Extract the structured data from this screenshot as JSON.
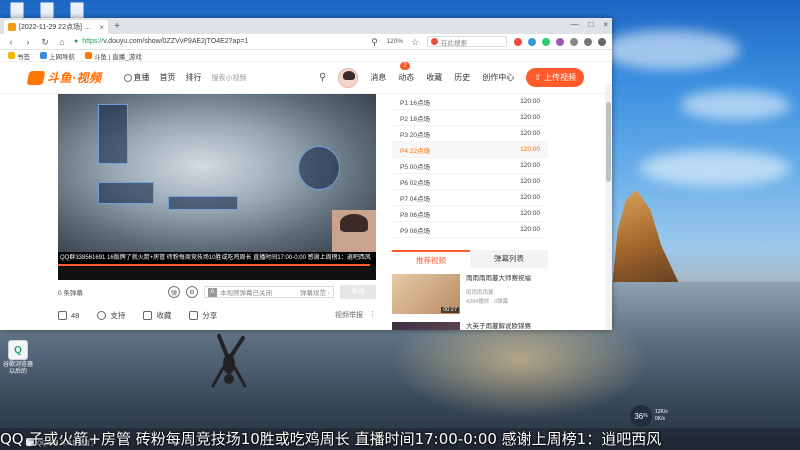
{
  "browser": {
    "tab": {
      "title": "[2022-11-29 22点场] 魔兽世界",
      "close": "×"
    },
    "new_tab": "+",
    "window_controls": [
      "—",
      "□",
      "×"
    ],
    "url": {
      "scheme": "https://",
      "rest": "v.douyu.com/show/0ZZVvP9AE2jTO4E2?ap=1"
    },
    "zoom": "120%",
    "search_placeholder": "在此搜索",
    "bookmarks": [
      "书签",
      "上网导航",
      "斗鱼 | 直播_游戏"
    ]
  },
  "site": {
    "logo_text": "斗鱼·视频",
    "nav": [
      "直播",
      "首页",
      "排行"
    ],
    "nav_muted": "搜索小视频",
    "right_links": [
      "消息",
      "动态",
      "收藏",
      "历史",
      "创作中心"
    ],
    "dynamic_badge": "2",
    "upload_label": "上传视频"
  },
  "video": {
    "ticker": "QQ群338561691 16版牌了就火箭+房管 砖粉每周竞技场10胜或吃鸡周长 直播时间17:00-0:00 感谢上周榜1：逍吧西风",
    "progress": 0.98
  },
  "player_bar": {
    "danmu_count": "0 条弹幕",
    "icon_a_label": "A",
    "danmu_closed": "本视频弹幕已关闭",
    "danmu_spec": "弹幕规范",
    "danmu_spec_arrow": "›",
    "send": "发送"
  },
  "actions": {
    "likes": "48",
    "support": "支持",
    "favorite": "收藏",
    "share": "分享",
    "report": "视频举报",
    "more": "⋮"
  },
  "playlist": [
    {
      "label": "P1 16点场",
      "duration": "120:00",
      "active": false
    },
    {
      "label": "P2 18点场",
      "duration": "120:00",
      "active": false
    },
    {
      "label": "P3 20点场",
      "duration": "120:00",
      "active": false
    },
    {
      "label": "P4 22点场",
      "duration": "120:00",
      "active": true
    },
    {
      "label": "P5 00点场",
      "duration": "120:00",
      "active": false
    },
    {
      "label": "P6 02点场",
      "duration": "120:00",
      "active": false
    },
    {
      "label": "P7 04点场",
      "duration": "120:00",
      "active": false
    },
    {
      "label": "P8 06点场",
      "duration": "120:00",
      "active": false
    },
    {
      "label": "P9 08点场",
      "duration": "120:00",
      "active": false
    }
  ],
  "rec_tabs": [
    "推荐视频",
    "弹幕列表"
  ],
  "recommend": [
    {
      "title": "雨雨雨雨蔓大师赛祝福",
      "author": "雨雨雨雨蔓",
      "meta": "4384播放 · 0弹幕",
      "duration": "00:27"
    },
    {
      "title": "大英子雨蔓解说欧锦赛",
      "author": "",
      "meta": "",
      "duration": ""
    }
  ],
  "desktop": {
    "app_label": "谷歌浏览器 以后的",
    "taskbar_label": "QQ截图 斗鱼直播看了"
  },
  "net": {
    "percent": "36",
    "percent_unit": "%",
    "up": "12K/s",
    "down": "0K/s"
  },
  "overlay_danmaku": "QQ                    子或火箭+房管 砖粉每周竞技场10胜或吃鸡周长 直播时间17:00-0:00 感谢上周榜1：逍吧西风",
  "colors": {
    "accent": "#ff5a2a",
    "douyu_orange": "#ff6a00"
  }
}
